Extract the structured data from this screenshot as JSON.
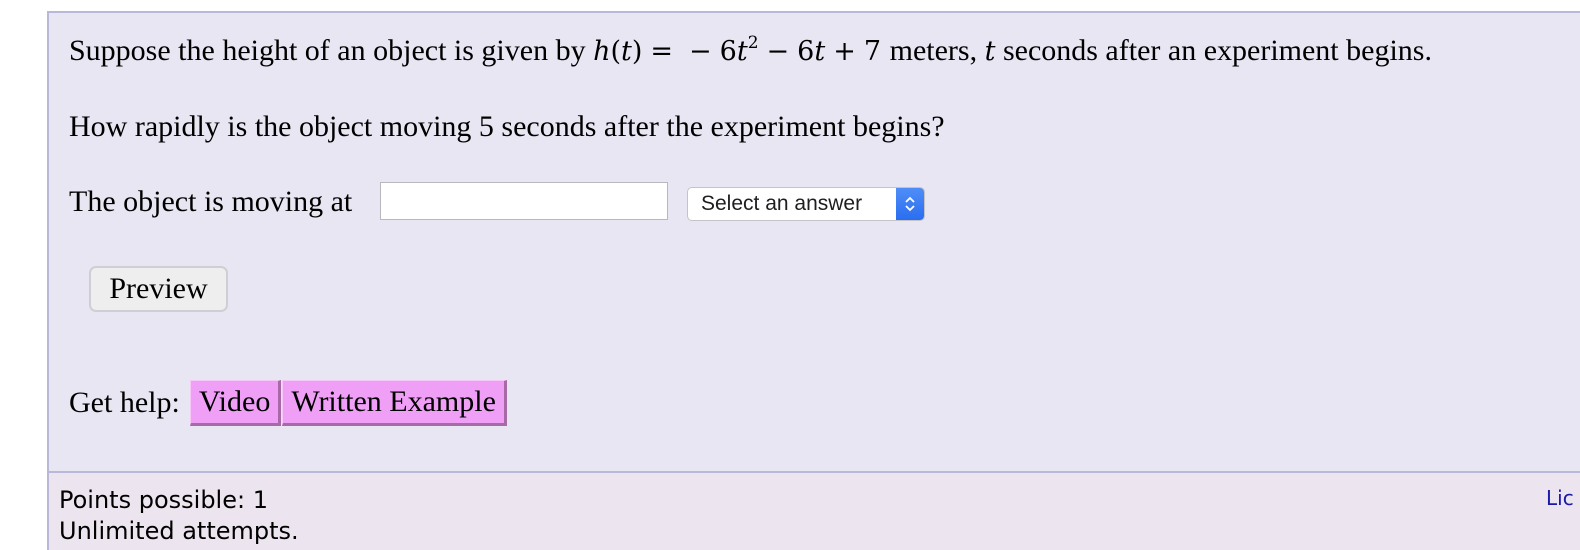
{
  "question": {
    "intro_text": "Suppose the height of an object is given by",
    "function_name": "h",
    "function_var": "t",
    "equals": "=",
    "expression": {
      "neg": "−",
      "coef1": "6",
      "var1": "t",
      "exp1": "2",
      "op2": "−",
      "coef2": "6",
      "var2": "t",
      "op3": "+",
      "const": "7"
    },
    "units_text": "meters,",
    "var_t": "t",
    "after_text": "seconds after an experiment begins.",
    "prompt": "How rapidly is the object moving 5 seconds after the experiment begins?",
    "answer_label": "The object is moving at"
  },
  "answer": {
    "input_value": "",
    "select_value": "Select an answer"
  },
  "buttons": {
    "preview": "Preview"
  },
  "help": {
    "label": "Get help:",
    "video": "Video",
    "written_example": "Written Example"
  },
  "footer": {
    "points": "Points possible: 1",
    "attempts": "Unlimited attempts.",
    "license_link": "Lic"
  },
  "colors": {
    "panel_bg": "#e8e6f2",
    "footer_bg": "#ece4ee",
    "border": "#b9b8d9",
    "help_button_bg": "#f09ff6",
    "select_arrow": "#2a6ef0",
    "link": "#1a1aa8"
  }
}
